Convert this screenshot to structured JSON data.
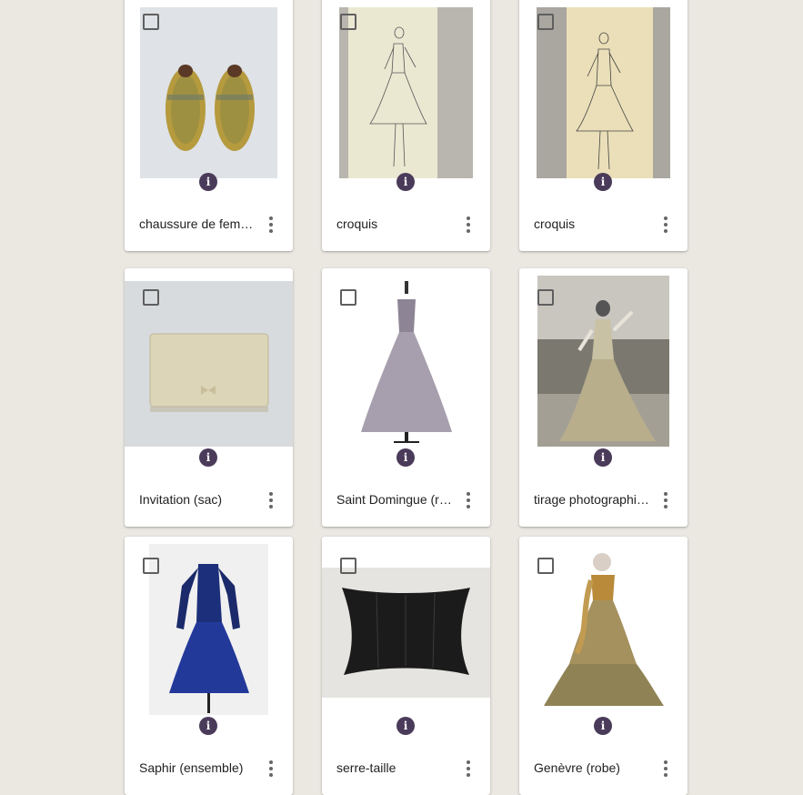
{
  "cards": [
    {
      "title": "chaussure de femme",
      "info_icon": "info-icon",
      "menu_icon": "more-vert-icon"
    },
    {
      "title": "croquis",
      "info_icon": "info-icon",
      "menu_icon": "more-vert-icon"
    },
    {
      "title": "croquis",
      "info_icon": "info-icon",
      "menu_icon": "more-vert-icon"
    },
    {
      "title": "Invitation (sac)",
      "info_icon": "info-icon",
      "menu_icon": "more-vert-icon"
    },
    {
      "title": "Saint Domingue (robe)",
      "info_icon": "info-icon",
      "menu_icon": "more-vert-icon"
    },
    {
      "title": "tirage photographique",
      "info_icon": "info-icon",
      "menu_icon": "more-vert-icon"
    },
    {
      "title": "Saphir (ensemble)",
      "info_icon": "info-icon",
      "menu_icon": "more-vert-icon"
    },
    {
      "title": "serre-taille",
      "info_icon": "info-icon",
      "menu_icon": "more-vert-icon"
    },
    {
      "title": "Genèvre (robe)",
      "info_icon": "info-icon",
      "menu_icon": "more-vert-icon"
    }
  ],
  "info_glyph": "i",
  "colors": {
    "background": "#ebe8e2",
    "card": "#ffffff",
    "info_badge": "#4a3b5a"
  }
}
